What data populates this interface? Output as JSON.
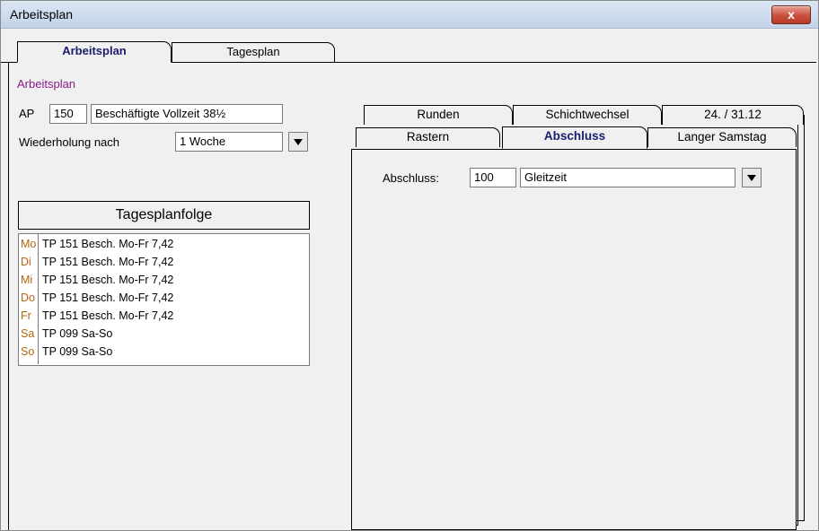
{
  "window": {
    "title": "Arbeitsplan",
    "close_label": "x"
  },
  "main_tabs": [
    {
      "label": "Arbeitsplan",
      "active": true
    },
    {
      "label": "Tagesplan",
      "active": false
    }
  ],
  "section_label": "Arbeitsplan",
  "ap": {
    "label": "AP",
    "number": "150",
    "name": "Beschäftigte Vollzeit 38½"
  },
  "wiederholung": {
    "label": "Wiederholung nach",
    "value": "1 Woche"
  },
  "tagesplanfolge": {
    "header": "Tagesplanfolge",
    "rows": [
      {
        "day": "Mo",
        "text": "TP 151  Besch. Mo-Fr 7,42"
      },
      {
        "day": "Di",
        "text": "TP 151  Besch. Mo-Fr 7,42"
      },
      {
        "day": "Mi",
        "text": "TP 151  Besch. Mo-Fr 7,42"
      },
      {
        "day": "Do",
        "text": "TP 151  Besch. Mo-Fr 7,42"
      },
      {
        "day": "Fr",
        "text": "TP 151  Besch. Mo-Fr 7,42"
      },
      {
        "day": "Sa",
        "text": "TP 099  Sa-So"
      },
      {
        "day": "So",
        "text": "TP 099  Sa-So"
      }
    ]
  },
  "right_tabs": {
    "row_back": [
      "Runden",
      "Schichtwechsel",
      "24. / 31.12"
    ],
    "row_front": [
      "Rastern",
      "Abschluss",
      "Langer Samstag"
    ],
    "active": "Abschluss"
  },
  "abschluss": {
    "label": "Abschluss:",
    "number": "100",
    "value": "Gleitzeit"
  },
  "colors": {
    "section_label": "#8b1a8b",
    "day_label": "#b5650e",
    "active_tab_text": "#1c1c6e"
  }
}
